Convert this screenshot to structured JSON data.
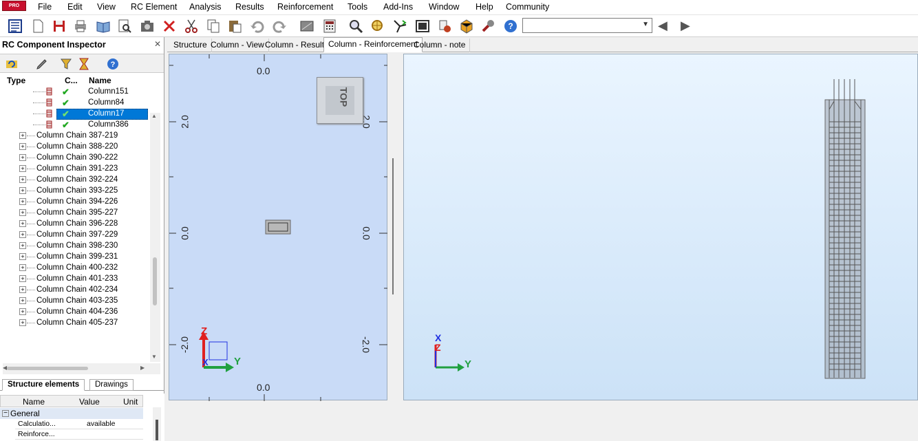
{
  "app": {
    "logo_text": "PRO"
  },
  "menu": [
    "File",
    "Edit",
    "View",
    "RC Element",
    "Analysis",
    "Results",
    "Reinforcement",
    "Tools",
    "Add-Ins",
    "Window",
    "Help",
    "Community"
  ],
  "toolbar": {
    "icons": [
      "inspector-icon",
      "new-icon",
      "save-icon",
      "print-icon",
      "open-book-icon",
      "preview-icon",
      "camera-icon",
      "delete-icon",
      "cut-icon",
      "copy-icon",
      "paste-icon",
      "undo-icon",
      "redo-icon",
      "display-icon",
      "calculator-icon",
      "zoom-icon",
      "zoom-window-icon",
      "axis-icon",
      "screen-capture-icon",
      "calculation-icon",
      "model-icon",
      "settings-wrench-icon",
      "help-icon"
    ],
    "combo_value": ""
  },
  "inspector": {
    "title": "RC Component Inspector",
    "columns": {
      "type": "Type",
      "c": "C...",
      "name": "Name"
    },
    "children": [
      {
        "name": "Column151",
        "selected": false
      },
      {
        "name": "Column84",
        "selected": false
      },
      {
        "name": "Column17",
        "selected": true
      },
      {
        "name": "Column386",
        "selected": false
      }
    ],
    "chains": [
      "Column Chain 387-219",
      "Column Chain 388-220",
      "Column Chain 390-222",
      "Column Chain 391-223",
      "Column Chain 392-224",
      "Column Chain 393-225",
      "Column Chain 394-226",
      "Column Chain 395-227",
      "Column Chain 396-228",
      "Column Chain 397-229",
      "Column Chain 398-230",
      "Column Chain 399-231",
      "Column Chain 400-232",
      "Column Chain 401-233",
      "Column Chain 402-234",
      "Column Chain 403-235",
      "Column Chain 404-236",
      "Column Chain 405-237"
    ],
    "bottom_tabs": [
      "Structure elements",
      "Drawings"
    ],
    "props": {
      "headers": {
        "name": "Name",
        "value": "Value",
        "unit": "Unit"
      },
      "group": "General",
      "rows": [
        {
          "name": "Calculatio...",
          "value": "available"
        },
        {
          "name": "Reinforce...",
          "value": ""
        }
      ]
    }
  },
  "doc_tabs": [
    "Structure",
    "Column - View",
    "Column - Results",
    "Column - Reinforcement",
    "Column - note"
  ],
  "active_tab_index": 3,
  "view1": {
    "ruler_top": "0.0",
    "ruler_bottom": "0.0",
    "left_labels": [
      "2.0",
      "0.0",
      "-2.0"
    ],
    "right_labels": [
      "2.0",
      "0.0",
      "-2.0"
    ],
    "cube_label": "TOP",
    "axis": {
      "z": "Z",
      "x": "X",
      "y": "Y"
    },
    "colors": {
      "bg": "#c9dbf7",
      "z": "#e02020",
      "y": "#20a040",
      "x": "#2030e0"
    }
  },
  "view2": {
    "axis": {
      "x": "X",
      "z": "Z",
      "y": "Y"
    }
  }
}
